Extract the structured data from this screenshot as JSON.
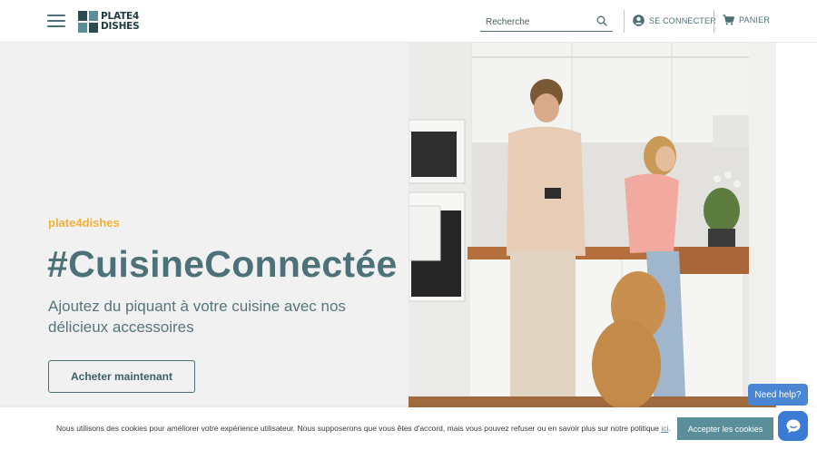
{
  "header": {
    "logo": {
      "line1": "PLATE4",
      "line2": "DISHES"
    },
    "search": {
      "placeholder": "Recherche"
    },
    "login_label": "SE CONNECTER",
    "cart_label": "PANIER"
  },
  "hero": {
    "eyebrow": "plate4dishes",
    "title": "#CuisineConnectée",
    "subtitle": "Ajoutez du piquant à votre cuisine avec nos délicieux accessoires",
    "cta_label": "Acheter maintenant"
  },
  "help": {
    "label": "Need help?"
  },
  "cookie": {
    "text": "Nous utilisons des cookies pour améliorer votre expérience utilisateur. Nous supposerons que vous êtes d'accord, mais vous pouvez refuser ou en savoir plus sur notre politique ",
    "link_label": "ici",
    "text_end": ".",
    "accept_label": "Accepter les cookies"
  },
  "colors": {
    "accent": "#5a8f99",
    "heading": "#4d7178",
    "eyebrow": "#f2b23a",
    "hero_bg": "#f1f1f1",
    "chat": "#3a7bd5"
  },
  "icons": [
    "menu-icon",
    "search-icon",
    "user-icon",
    "cart-icon",
    "chat-icon"
  ]
}
